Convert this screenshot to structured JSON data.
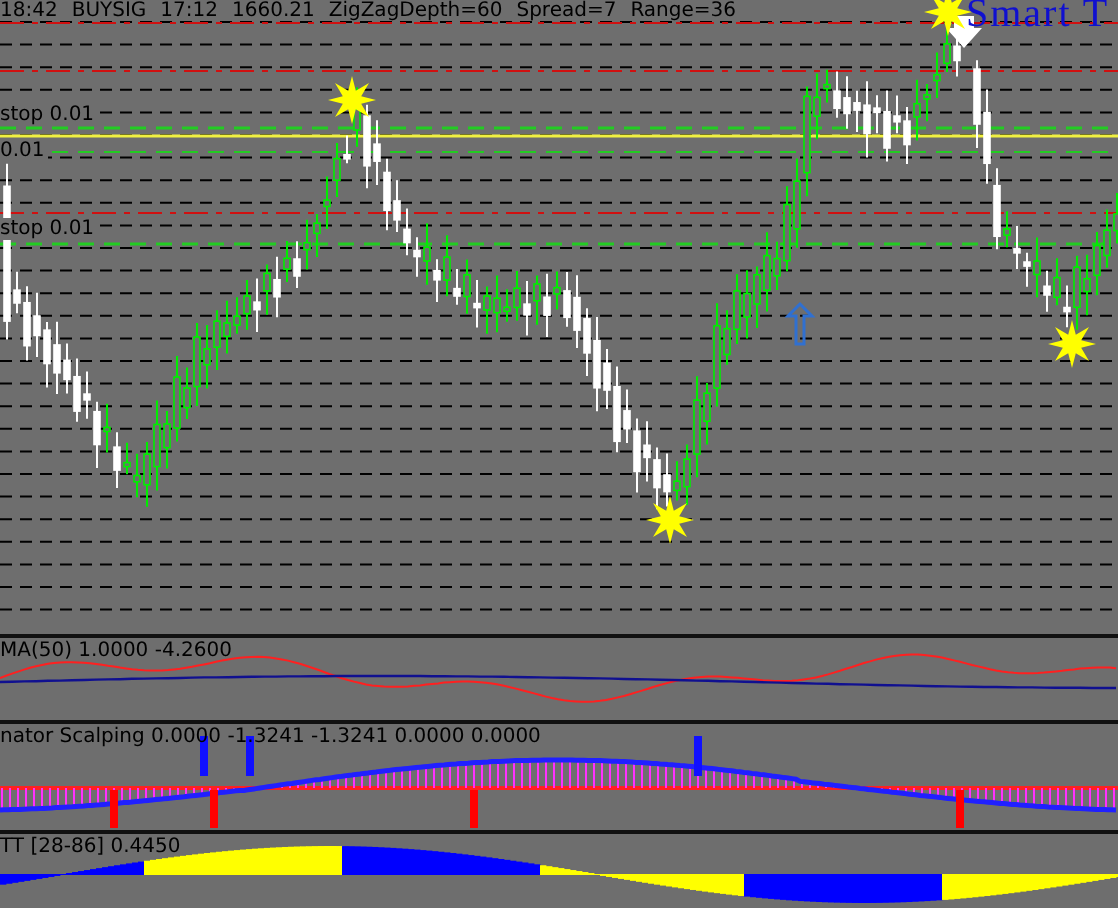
{
  "header": {
    "time": "18:42",
    "signal": "BUYSIG",
    "signal_time": "17:12",
    "price": "1660.21",
    "params": [
      "ZigZagDepth=60",
      "Spread=7",
      "Range=36"
    ]
  },
  "levels": [
    {
      "label": "stop 0.01",
      "kind": "stop"
    },
    {
      "label": "0.01",
      "kind": "line"
    },
    {
      "label": "stop 0.01",
      "kind": "stop"
    }
  ],
  "logo": {
    "text": "Smart T"
  },
  "indicators": [
    {
      "label": "MA(50) 1.0000 -4.2600",
      "kind": "ma"
    },
    {
      "label": "nator Scalping 0.0000 -1.3241 -1.3241 0.0000 0.0000",
      "kind": "histogram"
    },
    {
      "label": "TT [28-86] 0.4450",
      "kind": "wave"
    }
  ]
}
